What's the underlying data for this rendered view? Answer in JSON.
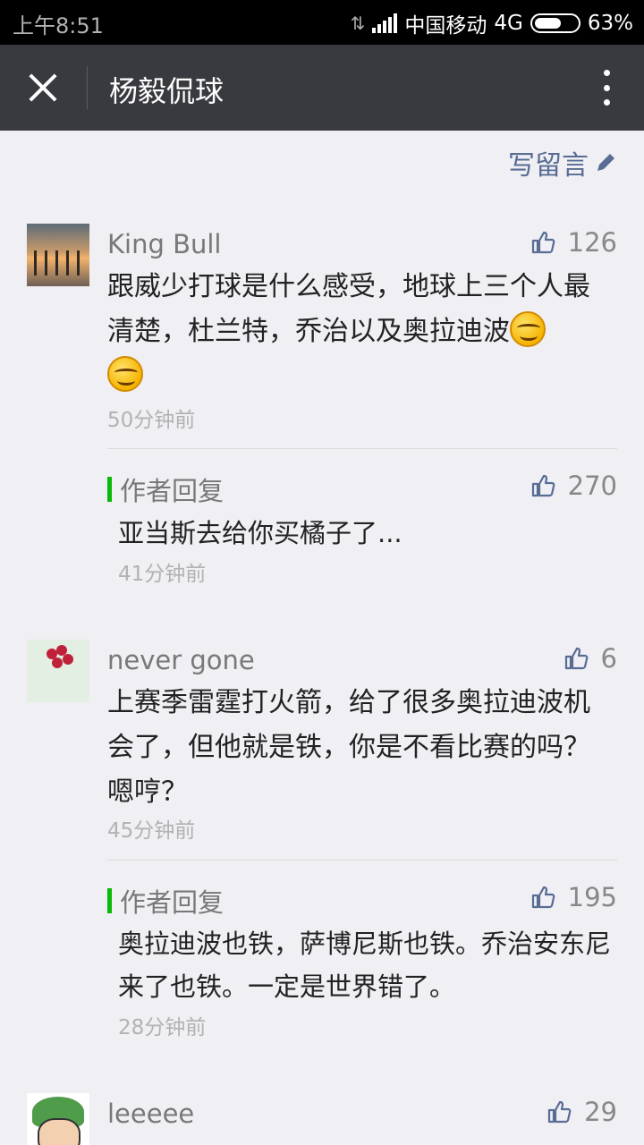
{
  "status_bar": {
    "time": "上午8:51",
    "carrier": "中国移动",
    "network": "4G",
    "battery_text": "63%",
    "battery_level": 0.63
  },
  "title_bar": {
    "title": "杨毅侃球",
    "close_icon": "close-icon",
    "more_icon": "more-vertical-icon"
  },
  "write_comment": {
    "label": "写留言",
    "icon": "pencil-icon"
  },
  "colors": {
    "titlebar": "#393a3f",
    "link": "#586c94",
    "reply_marker": "#09bb07"
  },
  "comments": [
    {
      "name": "King Bull",
      "likes": "126",
      "text": "跟威少打球是什么感受，地球上三个人最清楚，杜兰特，乔治以及奥拉迪波",
      "time": "50分钟前",
      "reply": {
        "label": "作者回复",
        "likes": "270",
        "text": "亚当斯去给你买橘子了...",
        "time": "41分钟前"
      }
    },
    {
      "name": "never gone",
      "likes": "6",
      "text": "上赛季雷霆打火箭，给了很多奥拉迪波机会了，但他就是铁，你是不看比赛的吗？嗯哼？",
      "time": "45分钟前",
      "reply": {
        "label": "作者回复",
        "likes": "195",
        "text": "奥拉迪波也铁，萨博尼斯也铁。乔治安东尼来了也铁。一定是世界错了。",
        "time": "28分钟前"
      }
    },
    {
      "name": "leeeee",
      "likes": "29"
    }
  ]
}
